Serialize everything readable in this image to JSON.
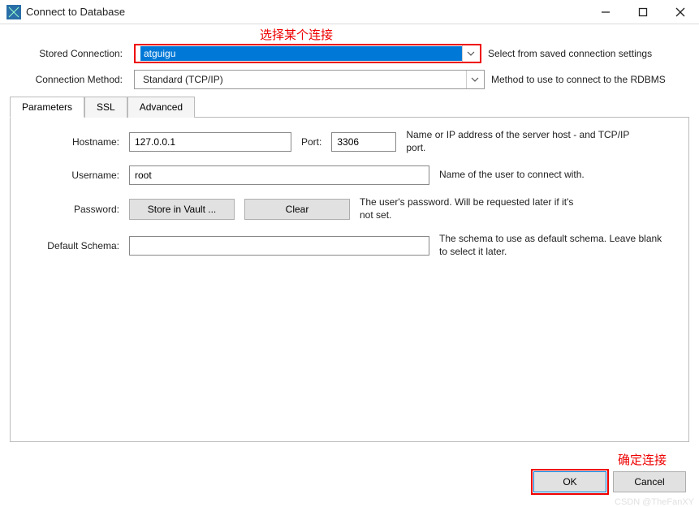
{
  "window": {
    "title": "Connect to Database"
  },
  "annotations": {
    "top": "选择某个连接",
    "bottom": "确定连接"
  },
  "form": {
    "stored_connection_label": "Stored Connection:",
    "stored_connection_value": "atguigu",
    "stored_connection_hint": "Select from saved connection settings",
    "method_label": "Connection Method:",
    "method_value": "Standard (TCP/IP)",
    "method_hint": "Method to use to connect to the RDBMS"
  },
  "tabs": {
    "parameters": "Parameters",
    "ssl": "SSL",
    "advanced": "Advanced"
  },
  "params": {
    "hostname_label": "Hostname:",
    "hostname_value": "127.0.0.1",
    "port_label": "Port:",
    "port_value": "3306",
    "hostname_desc": "Name or IP address of the server host - and TCP/IP port.",
    "username_label": "Username:",
    "username_value": "root",
    "username_desc": "Name of the user to connect with.",
    "password_label": "Password:",
    "store_btn": "Store in Vault ...",
    "clear_btn": "Clear",
    "password_desc": "The user's password. Will be requested later if it's not set.",
    "schema_label": "Default Schema:",
    "schema_value": "",
    "schema_desc": "The schema to use as default schema. Leave blank to select it later."
  },
  "footer": {
    "ok": "OK",
    "cancel": "Cancel"
  },
  "watermark": "CSDN @TheFanXY"
}
